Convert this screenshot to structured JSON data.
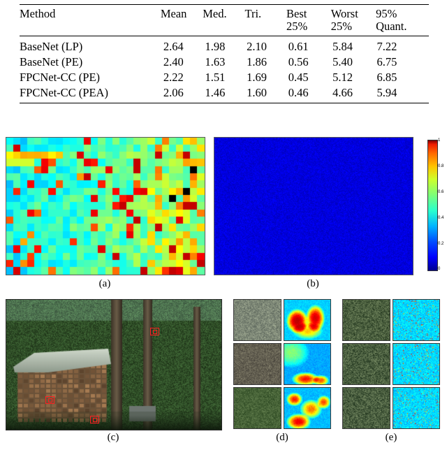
{
  "table": {
    "headers": [
      {
        "line1": "Method",
        "line2": ""
      },
      {
        "line1": "Mean",
        "line2": ""
      },
      {
        "line1": "Med.",
        "line2": ""
      },
      {
        "line1": "Tri.",
        "line2": ""
      },
      {
        "line1": "Best",
        "line2": "25%"
      },
      {
        "line1": "Worst",
        "line2": "25%"
      },
      {
        "line1": "95%",
        "line2": "Quant."
      }
    ],
    "rows": [
      {
        "method": "BaseNet (LP)",
        "mean": "2.64",
        "med": "1.98",
        "tri": "2.10",
        "best25": "0.61",
        "worst25": "5.84",
        "q95": "7.22"
      },
      {
        "method": "BaseNet (PE)",
        "mean": "2.40",
        "med": "1.63",
        "tri": "1.86",
        "best25": "0.56",
        "worst25": "5.40",
        "q95": "6.75"
      },
      {
        "method": "FPCNet-CC (PE)",
        "mean": "2.22",
        "med": "1.51",
        "tri": "1.69",
        "best25": "0.45",
        "worst25": "5.12",
        "q95": "6.85"
      },
      {
        "method": "FPCNet-CC (PEA)",
        "mean": "2.06",
        "med": "1.46",
        "tri": "1.60",
        "best25": "0.46",
        "worst25": "4.66",
        "q95": "5.94"
      }
    ]
  },
  "figure": {
    "captions": {
      "a": "(a)",
      "b": "(b)",
      "c": "(c)",
      "d": "(d)",
      "e": "(e)"
    },
    "colorbar": {
      "ticks": [
        "1",
        "0.8",
        "0.6",
        "0.4",
        "0.2",
        "0"
      ],
      "low_color": "#00008f",
      "high_color": "#800000"
    }
  },
  "chart_data": {
    "type": "heatmap",
    "title": "",
    "panels": [
      {
        "id": "a",
        "label": "(a)",
        "description": "coarse block heatmap, mostly mid-blue with scattered green/yellow/red hot blocks and two black blocks on the right",
        "grid": [
          28,
          19
        ],
        "vmin": 0,
        "vmax": 1,
        "mean_value": 0.45
      },
      {
        "id": "b",
        "label": "(b)",
        "description": "fine per-pixel noise map, uniformly low (deep blue)",
        "vmin": 0,
        "vmax": 1,
        "mean_value": 0.08
      }
    ],
    "colorbar": {
      "ticks": [
        1,
        0.8,
        0.6,
        0.4,
        0.2,
        0
      ],
      "ylim": [
        0,
        1
      ]
    }
  }
}
